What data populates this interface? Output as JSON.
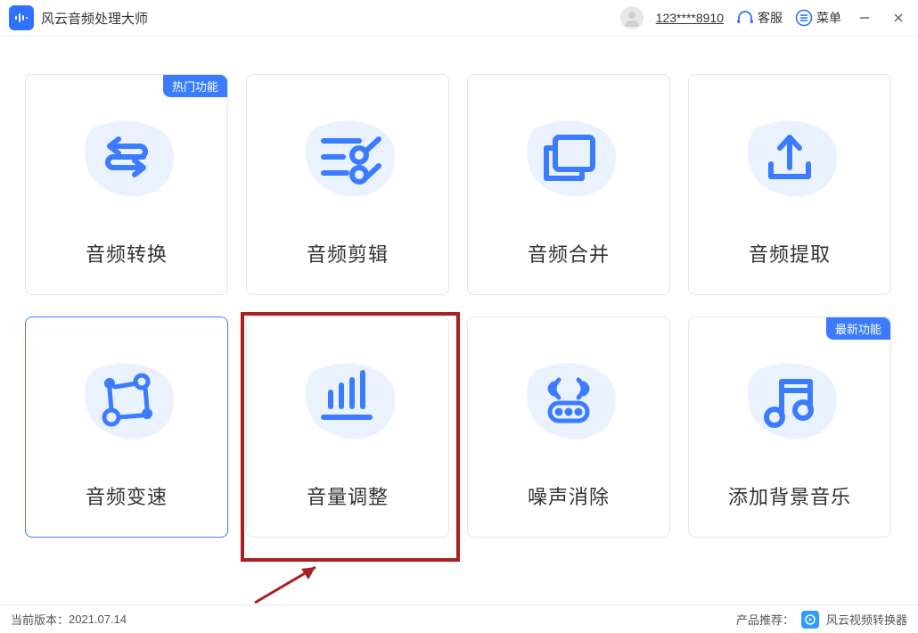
{
  "app": {
    "title": "风云音频处理大师"
  },
  "titlebar": {
    "user_id": "123****8910",
    "service": "客服",
    "menu": "菜单"
  },
  "cards": [
    {
      "label": "音频转换",
      "badge": "热门功能",
      "icon": "convert"
    },
    {
      "label": "音频剪辑",
      "badge": null,
      "icon": "cut"
    },
    {
      "label": "音频合并",
      "badge": null,
      "icon": "merge"
    },
    {
      "label": "音频提取",
      "badge": null,
      "icon": "extract"
    },
    {
      "label": "音频变速",
      "badge": null,
      "icon": "speed",
      "selected": true
    },
    {
      "label": "音量调整",
      "badge": null,
      "icon": "volume"
    },
    {
      "label": "噪声消除",
      "badge": null,
      "icon": "noise"
    },
    {
      "label": "添加背景音乐",
      "badge": "最新功能",
      "icon": "bgm"
    }
  ],
  "footer": {
    "version_label": "当前版本：",
    "version": "2021.07.14",
    "recommend_label": "产品推荐：",
    "recommend_product": "风云视频转换器"
  }
}
